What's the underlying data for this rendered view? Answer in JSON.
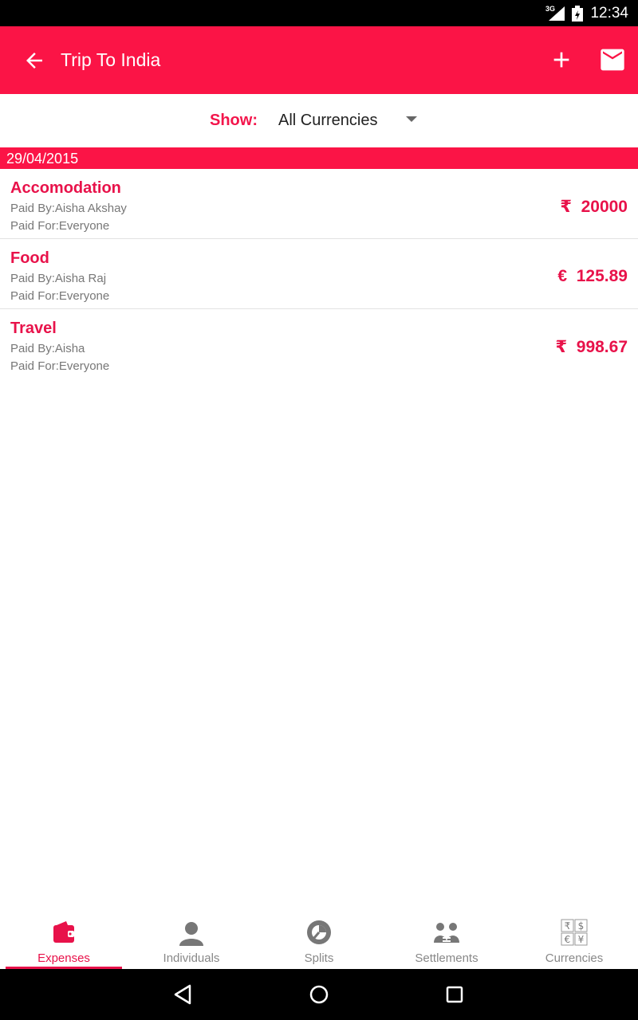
{
  "status_bar": {
    "network": "3G",
    "time": "12:34"
  },
  "app_bar": {
    "title": "Trip To India",
    "back_icon": "arrow-back-icon",
    "add_icon": "plus-icon",
    "mail_icon": "mail-icon"
  },
  "filter": {
    "label": "Show:",
    "value": "All Currencies"
  },
  "date_header": "29/04/2015",
  "expenses": [
    {
      "name": "Accomodation",
      "paid_by": "Paid By:Aisha Akshay",
      "paid_for": "Paid For:Everyone",
      "amount": "₹  20000"
    },
    {
      "name": "Food",
      "paid_by": "Paid By:Aisha Raj",
      "paid_for": "Paid For:Everyone",
      "amount": "€  125.89"
    },
    {
      "name": "Travel",
      "paid_by": "Paid By:Aisha",
      "paid_for": "Paid For:Everyone",
      "amount": "₹  998.67"
    }
  ],
  "bottom_nav": [
    {
      "label": "Expenses",
      "icon": "wallet-icon",
      "active": true
    },
    {
      "label": "Individuals",
      "icon": "person-icon",
      "active": false
    },
    {
      "label": "Splits",
      "icon": "pie-chart-icon",
      "active": false
    },
    {
      "label": "Settlements",
      "icon": "people-exchange-icon",
      "active": false
    },
    {
      "label": "Currencies",
      "icon": "currencies-icon",
      "active": false
    }
  ],
  "colors": {
    "accent": "#fb1446",
    "text_accent": "#e8124a",
    "muted": "#777777"
  }
}
